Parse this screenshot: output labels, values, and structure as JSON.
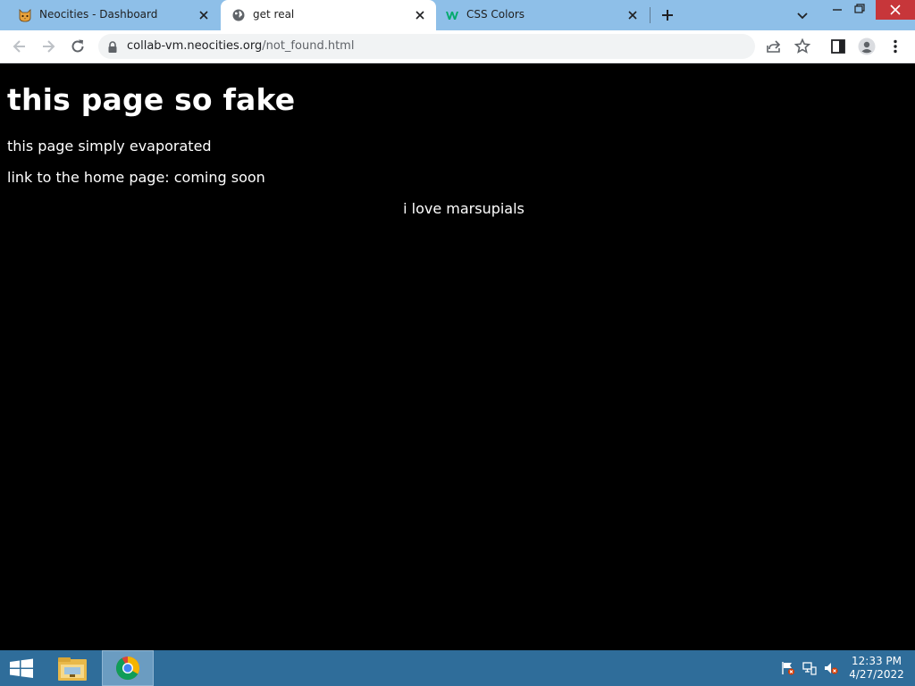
{
  "browser": {
    "tabs": [
      {
        "title": "Neocities - Dashboard",
        "icon": "neocities-cat-icon",
        "active": false
      },
      {
        "title": "get real",
        "icon": "globe-icon",
        "active": true
      },
      {
        "title": "CSS Colors",
        "icon": "w3schools-icon",
        "active": false
      }
    ],
    "address": {
      "host": "collab-vm.neocities.org",
      "path": "/not_found.html"
    },
    "colors": {
      "tabstrip": "#8ebfe8",
      "close_button": "#c7363a",
      "page_background": "#000000",
      "page_text": "#ffffff"
    }
  },
  "page": {
    "heading": "this page so fake",
    "line1": "this page simply evaporated",
    "line2": "link to the home page: coming soon",
    "line3": "i love marsupials"
  },
  "taskbar": {
    "items": [
      "start-icon",
      "file-explorer-icon",
      "chrome-icon"
    ],
    "clock_time": "12:33 PM",
    "clock_date": "4/27/2022",
    "color": "#2f6d9a"
  }
}
